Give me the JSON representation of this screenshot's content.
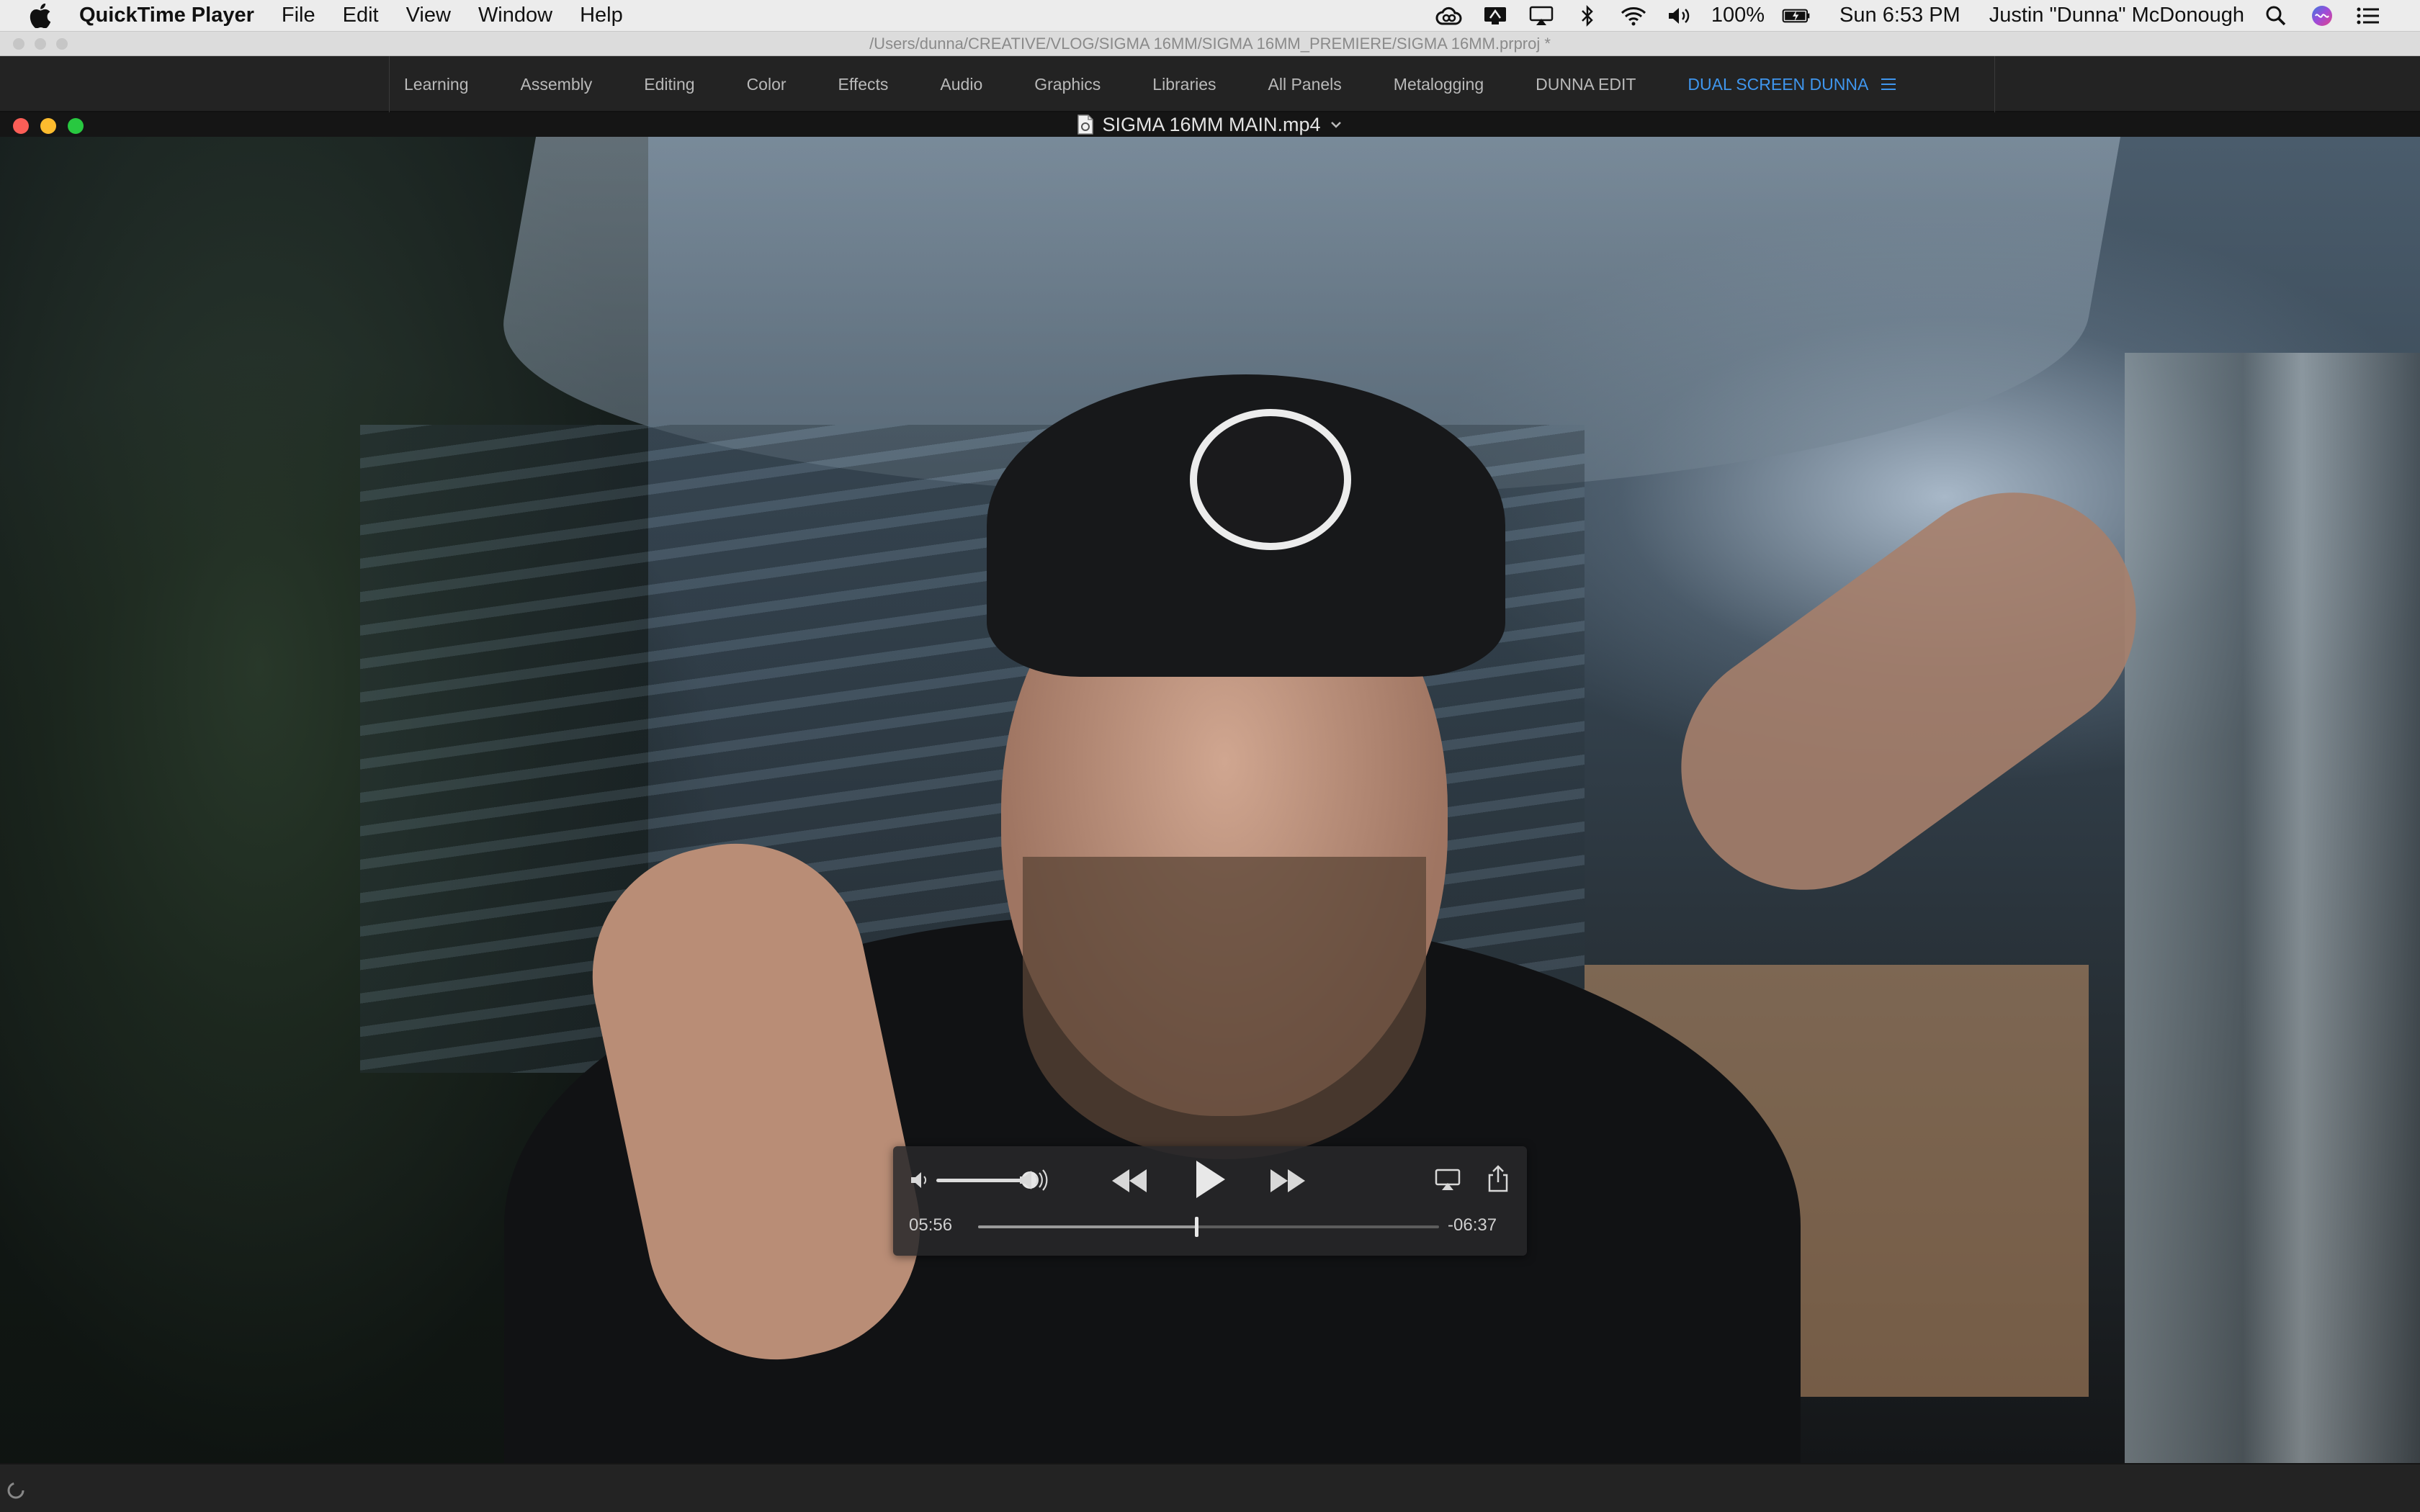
{
  "menubar": {
    "apple_icon": "apple-icon",
    "app_name": "QuickTime Player",
    "items": [
      "File",
      "Edit",
      "View",
      "Window",
      "Help"
    ],
    "status_icons": [
      "creative-cloud-icon",
      "app-store-icon",
      "airplay-icon",
      "bluetooth-icon",
      "wifi-icon",
      "volume-icon"
    ],
    "battery_percent": "100%",
    "clock": "Sun 6:53 PM",
    "user_name": "Justin \"Dunna\" McDonough",
    "spotlight_icon": "search-icon",
    "siri_icon": "siri-icon",
    "notification_icon": "list-icon"
  },
  "premiere": {
    "title_path": "/Users/dunna/CREATIVE/VLOG/SIGMA 16MM/SIGMA 16MM_PREMIERE/SIGMA 16MM.prproj *",
    "workspaces": [
      "Learning",
      "Assembly",
      "Editing",
      "Color",
      "Effects",
      "Audio",
      "Graphics",
      "Libraries",
      "All Panels",
      "Metalogging",
      "DUNNA EDIT"
    ],
    "active_workspace": "DUAL SCREEN DUNNA",
    "accent_color": "#3f96ee"
  },
  "quicktime": {
    "window_title": "SIGMA 16MM MAIN.mp4",
    "controls": {
      "elapsed": "05:56",
      "remaining": "-06:37",
      "progress_fraction": 0.473,
      "volume_fraction": 1.0
    }
  }
}
